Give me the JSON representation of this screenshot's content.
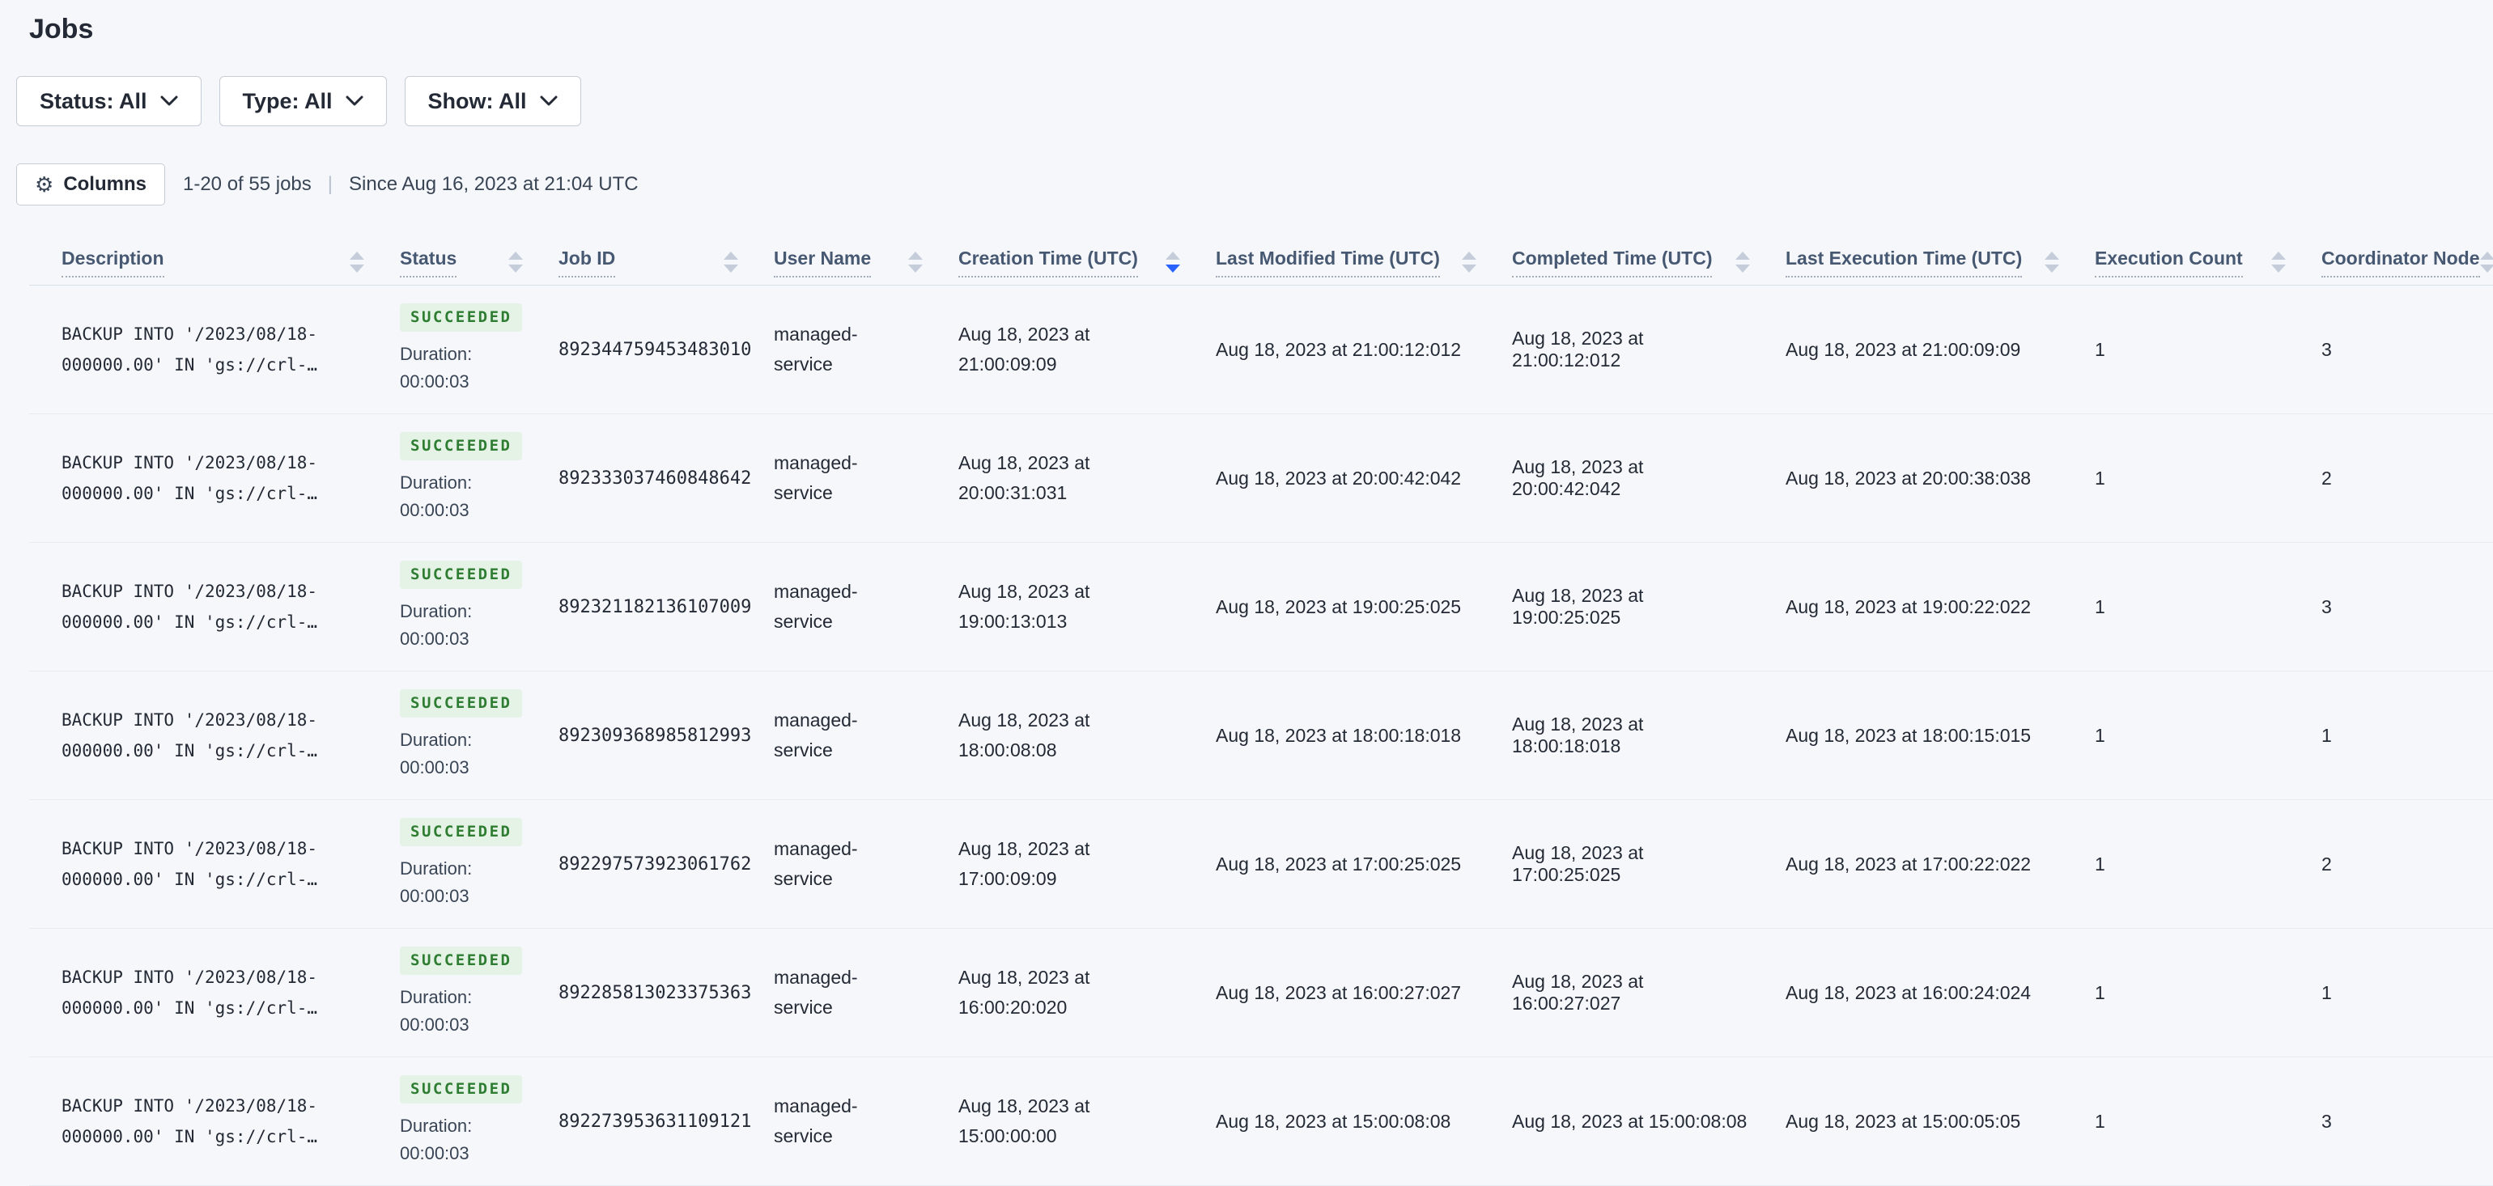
{
  "page": {
    "title": "Jobs"
  },
  "filters": [
    {
      "id": "status",
      "label": "Status: All"
    },
    {
      "id": "type",
      "label": "Type: All"
    },
    {
      "id": "show",
      "label": "Show: All"
    }
  ],
  "toolbar": {
    "columns_label": "Columns",
    "count": "1-20 of 55 jobs",
    "separator": "|",
    "since": "Since Aug 16, 2023 at 21:04 UTC"
  },
  "icons": {
    "gear-icon": "⚙"
  },
  "colors": {
    "page_bg": "#F5F7FA",
    "text_dark": "#242A35",
    "text_muted": "#394455",
    "header_label": "#475872",
    "accent_blue": "#2962FF",
    "success_bg": "#E5F3E6",
    "success_text": "#2E7D32"
  },
  "table": {
    "columns": [
      {
        "id": "description",
        "label": "Description",
        "sort": "none"
      },
      {
        "id": "status",
        "label": "Status",
        "sort": "none"
      },
      {
        "id": "job-id",
        "label": "Job ID",
        "sort": "none"
      },
      {
        "id": "user-name",
        "label": "User Name",
        "sort": "none"
      },
      {
        "id": "creation-time",
        "label": "Creation Time (UTC)",
        "sort": "desc"
      },
      {
        "id": "last-modified-time",
        "label": "Last Modified Time (UTC)",
        "sort": "none"
      },
      {
        "id": "completed-time",
        "label": "Completed Time (UTC)",
        "sort": "none"
      },
      {
        "id": "last-execution-time",
        "label": "Last Execution Time (UTC)",
        "sort": "none"
      },
      {
        "id": "execution-count",
        "label": "Execution Count",
        "sort": "none"
      },
      {
        "id": "coordinator-node",
        "label": "Coordinator Node",
        "sort": "none"
      }
    ],
    "rows": [
      {
        "description": [
          "BACKUP INTO '/2023/08/18-",
          "000000.00' IN 'gs://crl-…"
        ],
        "status": "SUCCEEDED",
        "duration": [
          "Duration:",
          "00:00:03"
        ],
        "job_id": "892344759453483010",
        "user": [
          "managed-",
          "service"
        ],
        "creation": [
          "Aug 18, 2023 at",
          "21:00:09:09"
        ],
        "last_modified": "Aug 18, 2023 at 21:00:12:012",
        "completed": "Aug 18, 2023 at 21:00:12:012",
        "last_execution": "Aug 18, 2023 at 21:00:09:09",
        "execution_count": "1",
        "coordinator_node": "3"
      },
      {
        "description": [
          "BACKUP INTO '/2023/08/18-",
          "000000.00' IN 'gs://crl-…"
        ],
        "status": "SUCCEEDED",
        "duration": [
          "Duration:",
          "00:00:03"
        ],
        "job_id": "892333037460848642",
        "user": [
          "managed-",
          "service"
        ],
        "creation": [
          "Aug 18, 2023 at",
          "20:00:31:031"
        ],
        "last_modified": "Aug 18, 2023 at 20:00:42:042",
        "completed": "Aug 18, 2023 at 20:00:42:042",
        "last_execution": "Aug 18, 2023 at 20:00:38:038",
        "execution_count": "1",
        "coordinator_node": "2"
      },
      {
        "description": [
          "BACKUP INTO '/2023/08/18-",
          "000000.00' IN 'gs://crl-…"
        ],
        "status": "SUCCEEDED",
        "duration": [
          "Duration:",
          "00:00:03"
        ],
        "job_id": "892321182136107009",
        "user": [
          "managed-",
          "service"
        ],
        "creation": [
          "Aug 18, 2023 at",
          "19:00:13:013"
        ],
        "last_modified": "Aug 18, 2023 at 19:00:25:025",
        "completed": "Aug 18, 2023 at 19:00:25:025",
        "last_execution": "Aug 18, 2023 at 19:00:22:022",
        "execution_count": "1",
        "coordinator_node": "3"
      },
      {
        "description": [
          "BACKUP INTO '/2023/08/18-",
          "000000.00' IN 'gs://crl-…"
        ],
        "status": "SUCCEEDED",
        "duration": [
          "Duration:",
          "00:00:03"
        ],
        "job_id": "892309368985812993",
        "user": [
          "managed-",
          "service"
        ],
        "creation": [
          "Aug 18, 2023 at",
          "18:00:08:08"
        ],
        "last_modified": "Aug 18, 2023 at 18:00:18:018",
        "completed": "Aug 18, 2023 at 18:00:18:018",
        "last_execution": "Aug 18, 2023 at 18:00:15:015",
        "execution_count": "1",
        "coordinator_node": "1"
      },
      {
        "description": [
          "BACKUP INTO '/2023/08/18-",
          "000000.00' IN 'gs://crl-…"
        ],
        "status": "SUCCEEDED",
        "duration": [
          "Duration:",
          "00:00:03"
        ],
        "job_id": "892297573923061762",
        "user": [
          "managed-",
          "service"
        ],
        "creation": [
          "Aug 18, 2023 at",
          "17:00:09:09"
        ],
        "last_modified": "Aug 18, 2023 at 17:00:25:025",
        "completed": "Aug 18, 2023 at 17:00:25:025",
        "last_execution": "Aug 18, 2023 at 17:00:22:022",
        "execution_count": "1",
        "coordinator_node": "2"
      },
      {
        "description": [
          "BACKUP INTO '/2023/08/18-",
          "000000.00' IN 'gs://crl-…"
        ],
        "status": "SUCCEEDED",
        "duration": [
          "Duration:",
          "00:00:03"
        ],
        "job_id": "892285813023375363",
        "user": [
          "managed-",
          "service"
        ],
        "creation": [
          "Aug 18, 2023 at",
          "16:00:20:020"
        ],
        "last_modified": "Aug 18, 2023 at 16:00:27:027",
        "completed": "Aug 18, 2023 at 16:00:27:027",
        "last_execution": "Aug 18, 2023 at 16:00:24:024",
        "execution_count": "1",
        "coordinator_node": "1"
      },
      {
        "description": [
          "BACKUP INTO '/2023/08/18-",
          "000000.00' IN 'gs://crl-…"
        ],
        "status": "SUCCEEDED",
        "duration": [
          "Duration:",
          "00:00:03"
        ],
        "job_id": "892273953631109121",
        "user": [
          "managed-",
          "service"
        ],
        "creation": [
          "Aug 18, 2023 at",
          "15:00:00:00"
        ],
        "last_modified": "Aug 18, 2023 at 15:00:08:08",
        "completed": "Aug 18, 2023 at 15:00:08:08",
        "last_execution": "Aug 18, 2023 at 15:00:05:05",
        "execution_count": "1",
        "coordinator_node": "3"
      }
    ]
  }
}
